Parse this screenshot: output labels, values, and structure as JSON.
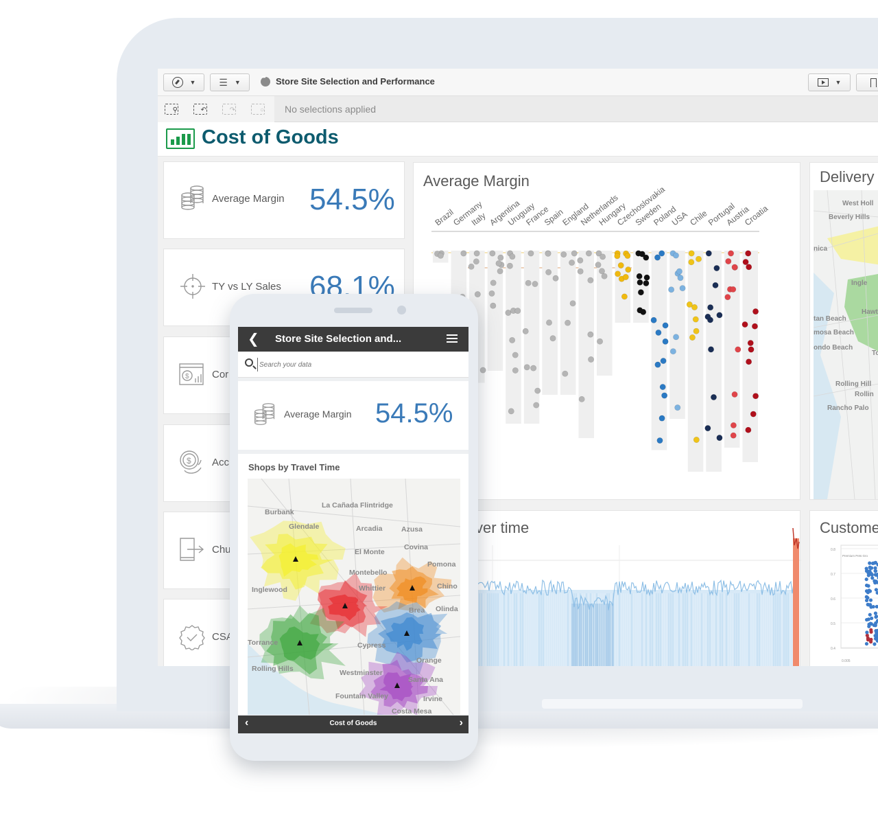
{
  "app": {
    "title": "Store Site Selection and Performance",
    "selection_status": "No selections applied",
    "sheet_title": "Cost of Goods"
  },
  "toolbar": {
    "nav_button": "compass-icon",
    "list_button": "list-icon",
    "present_button": "present-icon",
    "bookmark_button": "bookmark-icon",
    "selection_tools": [
      "smart-search-icon",
      "step-back-icon",
      "step-forward-icon",
      "clear-selections-icon"
    ]
  },
  "kpis": [
    {
      "label": "Average Margin",
      "value": "54.5%",
      "icon": "coins-icon"
    },
    {
      "label": "TY vs LY Sales",
      "value": "68.1%",
      "icon": "target-icon"
    },
    {
      "label": "Cor",
      "icon": "dollar-chart-icon"
    },
    {
      "label": "Acc",
      "icon": "coin-stack-icon"
    },
    {
      "label": "Chu",
      "icon": "exit-door-icon"
    },
    {
      "label": "CSAT",
      "icon": "badge-check-icon"
    }
  ],
  "charts": {
    "avg_margin_title": "Average Margin",
    "over_time_title": "ver time",
    "delivery_title": "Delivery",
    "customer_title": "Custome",
    "customer_axis_ticks": [
      "0.8",
      "0.7",
      "0.6",
      "0.5",
      "0.4"
    ],
    "customer_series_label": "Premium Pets Gro",
    "customer_x_tick": "0.005"
  },
  "delivery_map": {
    "labels": [
      "West Holl",
      "Beverly Hills",
      "nica",
      "Ingle",
      "Hawt",
      "tan Beach",
      "mosa Beach",
      "ondo Beach",
      "To",
      "Rolling Hill",
      "Rollin",
      "Rancho Palo"
    ]
  },
  "chart_data": {
    "type": "scatter",
    "title": "Average Margin",
    "categories": [
      "Brazil",
      "Germany",
      "Italy",
      "Argentina",
      "Uruguay",
      "France",
      "Spain",
      "England",
      "Netherlands",
      "Hungary",
      "Czechoslovakia",
      "Sweden",
      "Poland",
      "USA",
      "Chile",
      "Portugal",
      "Austria",
      "Croatia"
    ],
    "category_colors": [
      "#b5b5b5",
      "#b5b5b5",
      "#b5b5b5",
      "#b5b5b5",
      "#b5b5b5",
      "#b5b5b5",
      "#b5b5b5",
      "#b5b5b5",
      "#b5b5b5",
      "#b5b5b5",
      "#f0b90f",
      "#111111",
      "#2b7ac4",
      "#7cb2e0",
      "#f0c419",
      "#1a2e55",
      "#e0454a",
      "#b0101c"
    ],
    "series_depth": [
      0.05,
      0.95,
      0.55,
      0.5,
      0.72,
      0.72,
      0.6,
      0.6,
      0.78,
      0.52,
      0.3,
      0.3,
      0.83,
      0.7,
      0.92,
      0.92,
      0.82,
      0.88
    ],
    "points_per_category": [
      3,
      6,
      6,
      8,
      10,
      8,
      6,
      6,
      7,
      6,
      10,
      10,
      12,
      10,
      9,
      11,
      11,
      12
    ],
    "reference_lines": [
      "target",
      "average"
    ],
    "xlabel": "",
    "ylabel": ""
  },
  "phone": {
    "header_title": "Store Site Selection and...",
    "search_placeholder": "Search your data",
    "kpi_label": "Average Margin",
    "kpi_value": "54.5%",
    "map_title": "Shops by Travel Time",
    "footer_title": "Cost of Goods",
    "map_labels": [
      "La Cañada Flintridge",
      "Burbank",
      "Glendale",
      "Arcadia",
      "Azusa",
      "Covina",
      "El Monte",
      "Pomona",
      "Montebello",
      "Chino",
      "Inglewood",
      "Whittier",
      "Brea",
      "Olinda",
      "Torrance",
      "Cypress",
      "Rolling Hills",
      "Orange",
      "Westminster",
      "Santa Ana",
      "Fountain Valley",
      "Irvine",
      "Costa Mesa"
    ]
  }
}
